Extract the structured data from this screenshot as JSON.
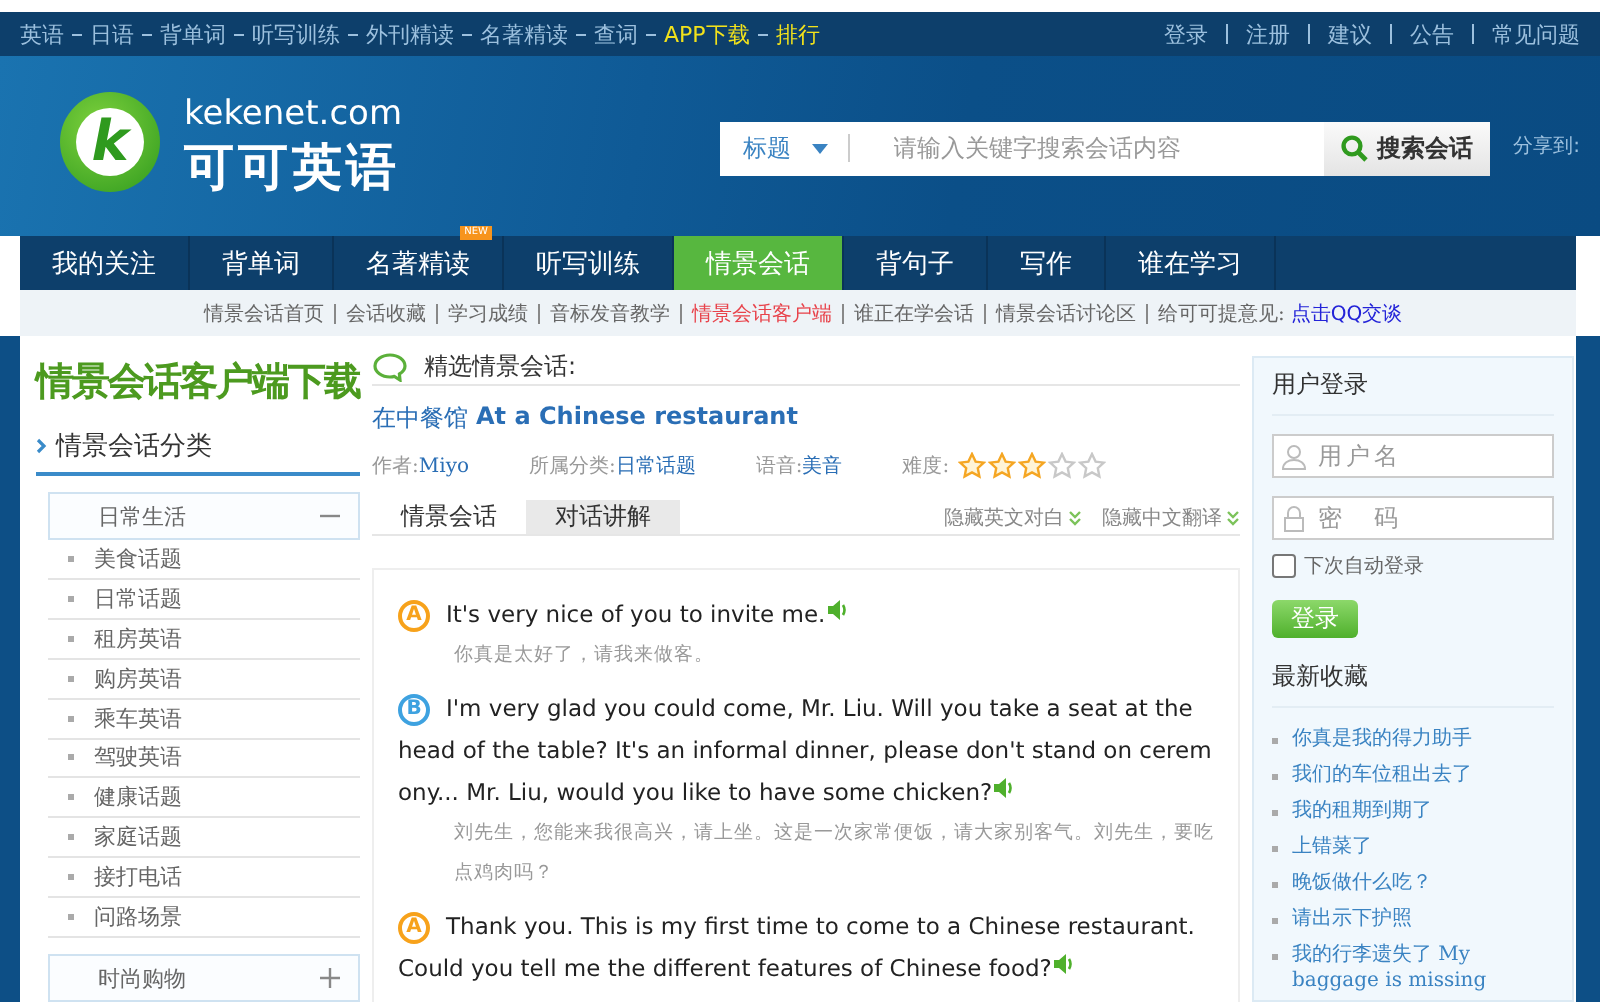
{
  "top_links": [
    {
      "label": "英语",
      "highlighted": false
    },
    {
      "label": "日语",
      "highlighted": false
    },
    {
      "label": "背单词",
      "highlighted": false
    },
    {
      "label": "听写训练",
      "highlighted": false
    },
    {
      "label": "外刊精读",
      "highlighted": false
    },
    {
      "label": "名著精读",
      "highlighted": false
    },
    {
      "label": "查词",
      "highlighted": false
    },
    {
      "label": "APP下载",
      "highlighted": true
    },
    {
      "label": "排行",
      "highlighted": true
    }
  ],
  "account_links": [
    "登录",
    "注册",
    "建议",
    "公告",
    "常见问题"
  ],
  "logo": {
    "mark": "k",
    "domain": "kekenet.com",
    "name": "可可英语"
  },
  "search": {
    "scope": "标题",
    "placeholder": "请输入关键字搜索会话内容",
    "button": "搜索会话"
  },
  "share_label": "分享到:",
  "nav": [
    {
      "label": "我的关注",
      "selected": false
    },
    {
      "label": "背单词",
      "selected": false
    },
    {
      "label": "名著精读",
      "selected": false,
      "badge": "NEW"
    },
    {
      "label": "听写训练",
      "selected": false
    },
    {
      "label": "情景会话",
      "selected": true
    },
    {
      "label": "背句子",
      "selected": false
    },
    {
      "label": "写作",
      "selected": false
    },
    {
      "label": "谁在学习",
      "selected": false
    }
  ],
  "subnav": [
    {
      "label": "情景会话首页",
      "kind": "plain"
    },
    {
      "label": "会话收藏",
      "kind": "plain"
    },
    {
      "label": "学习成绩",
      "kind": "plain"
    },
    {
      "label": "音标发音教学",
      "kind": "plain"
    },
    {
      "label": "情景会话客户端",
      "kind": "hot"
    },
    {
      "label": "谁正在学会话",
      "kind": "plain"
    },
    {
      "label": "情景会话讨论区",
      "kind": "plain"
    },
    {
      "label": "给可可提意见:",
      "kind": "note",
      "link": "点击QQ交谈"
    }
  ],
  "sidebar": {
    "banner": "情景会话客户端下载",
    "title": "情景会话分类",
    "groups": [
      {
        "label": "日常生活",
        "expanded": true,
        "children": [
          "美食话题",
          "日常话题",
          "租房英语",
          "购房英语",
          "乘车英语",
          "驾驶英语",
          "健康话题",
          "家庭话题",
          "接打电话",
          "问路场景"
        ]
      },
      {
        "label": "时尚购物",
        "expanded": false
      }
    ]
  },
  "dialog": {
    "section_title": "精选情景会话:",
    "title_zh": "在中餐馆",
    "title_en": "At a Chinese restaurant",
    "meta": [
      {
        "label": "作者:",
        "value": "Miyo"
      },
      {
        "label": "所属分类:",
        "value": "日常话题"
      },
      {
        "label": "语音:",
        "value": "美音"
      }
    ],
    "difficulty_label": "难度:",
    "stars": 3,
    "tabs": [
      {
        "label": "情景会话",
        "selected": true
      },
      {
        "label": "对话讲解",
        "selected": false
      }
    ],
    "toggles": [
      "隐藏英文对白",
      "隐藏中文翻译"
    ],
    "lines": [
      {
        "speaker": "A",
        "color": "#f7a21b",
        "en": "It's very nice of you to invite me.",
        "zh": "你真是太好了，请我来做客。"
      },
      {
        "speaker": "B",
        "color": "#3ea2e0",
        "en": "I'm very glad you could come, Mr. Liu. Will you take a seat at the head of the table? It's an informal dinner, please don't stand on ceremony... Mr. Liu, would you like to have some chicken?",
        "zh": "刘先生，您能来我很高兴，请上坐。这是一次家常便饭，请大家别客气。刘先生，要吃点鸡肉吗？"
      },
      {
        "speaker": "A",
        "color": "#f7a21b",
        "en": "Thank you. This is my first time to come to a Chinese restaurant. Could you tell me the different features of Chinese food?"
      }
    ]
  },
  "login": {
    "title": "用户登录",
    "username_placeholder": "用户名",
    "password_placeholder": "密　码",
    "remember_label": "下次自动登录",
    "remember": false,
    "button": "登录"
  },
  "recent": {
    "title": "最新收藏",
    "items": [
      "你真是我的得力助手",
      "我们的车位租出去了",
      "我的租期到期了",
      "上错菜了",
      "晚饭做什么吃？",
      "请出示下护照",
      "我的行李遗失了 My baggage is missing"
    ]
  }
}
